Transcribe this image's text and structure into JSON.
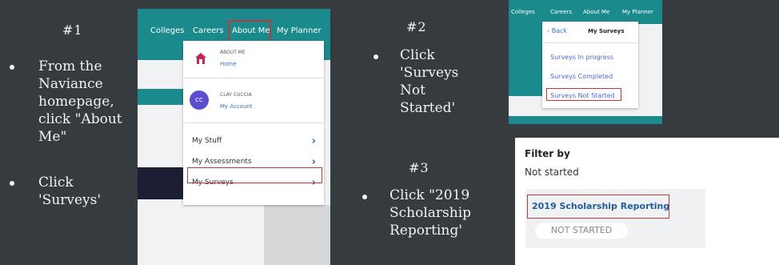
{
  "steps": {
    "s1": {
      "num": "#1",
      "b1": [
        "From the",
        "Naviance",
        "homepage,",
        "click \"About",
        "Me\""
      ],
      "b2": [
        "Click",
        "'Surveys'"
      ]
    },
    "s2": {
      "num": "#2",
      "b1": [
        "Click",
        "'Surveys",
        "Not",
        "Started'"
      ]
    },
    "s3": {
      "num": "#3",
      "b1": [
        "Click \"2019",
        "Scholarship",
        "Reporting'"
      ]
    }
  },
  "panel1": {
    "nav": [
      "Colleges",
      "Careers",
      "About Me",
      "My Planner"
    ],
    "about_head": "ABOUT ME",
    "about_link": "Home",
    "user_name": "CLAY CUCCIA",
    "user_link": "My Account",
    "avatar": "CC",
    "items": [
      "My Stuff",
      "My Assessments",
      "My Surveys"
    ]
  },
  "panel2": {
    "nav": [
      "Colleges",
      "Careers",
      "About Me",
      "My Planner"
    ],
    "back": "Back",
    "heading": "My Surveys",
    "links": [
      "Surveys In progress",
      "Surveys Completed",
      "Surveys Not Started"
    ]
  },
  "panel3": {
    "filter_label": "Filter by",
    "filter_value": "Not started",
    "survey_title": "2019 Scholarship Reporting",
    "status": "NOT STARTED"
  },
  "colors": {
    "teal": "#1b8a8c",
    "highlight": "#c03a3a",
    "background": "#353b3f"
  }
}
